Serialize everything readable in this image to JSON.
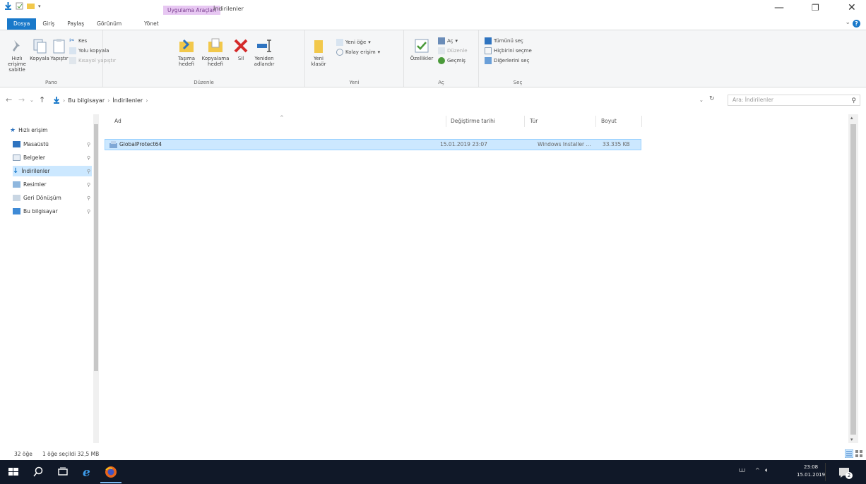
{
  "window": {
    "context_tab": "Uygulama Araçları",
    "title": "İndirilenler"
  },
  "ribbon_tabs": {
    "file": "Dosya",
    "home": "Giriş",
    "share": "Paylaş",
    "view": "Görünüm",
    "manage": "Yönet"
  },
  "ribbon": {
    "pin_quick": "Hızlı erişime sabitle",
    "copy": "Kopyala",
    "paste": "Yapıştır",
    "cut": "Kes",
    "copy_path": "Yolu kopyala",
    "paste_shortcut": "Kısayol yapıştır",
    "clipboard_label": "Pano",
    "move_to": "Taşıma hedefi",
    "copy_to": "Kopyalama hedefi",
    "delete": "Sil",
    "rename": "Yeniden adlandır",
    "organize_label": "Düzenle",
    "new_folder": "Yeni klasör",
    "new_item": "Yeni öğe",
    "easy_access": "Kolay erişim",
    "new_label": "Yeni",
    "properties": "Özellikler",
    "open": "Aç",
    "edit": "Düzenle",
    "history": "Geçmiş",
    "open_label": "Aç",
    "select_all": "Tümünü seç",
    "select_none": "Hiçbirini seçme",
    "invert_selection": "Diğerlerini seç",
    "select_label": "Seç"
  },
  "address": {
    "seg1": "Bu bilgisayar",
    "seg2": "İndirilenler",
    "search_placeholder": "Ara: İndirilenler"
  },
  "nav_pane": {
    "quick_access": "Hızlı erişim",
    "items": [
      {
        "label": "Masaüstü"
      },
      {
        "label": "Belgeler"
      },
      {
        "label": "İndirilenler"
      },
      {
        "label": "Resimler"
      },
      {
        "label": "Geri Dönüşüm"
      },
      {
        "label": "Bu bilgisayar"
      }
    ]
  },
  "columns": {
    "name": "Ad",
    "modified": "Değiştirme tarihi",
    "type": "Tür",
    "size": "Boyut"
  },
  "files": [
    {
      "name": "GlobalProtect64",
      "modified": "15.01.2019 23:07",
      "type": "Windows Installer ...",
      "size": "33.335 KB"
    }
  ],
  "status": {
    "count": "32 öğe",
    "selection": "1 öğe seçildi 32,5 MB"
  },
  "taskbar": {
    "time": "23:08",
    "date": "15.01.2019",
    "notif_count": "2"
  },
  "colors": {
    "accent": "#1979ca",
    "selection": "#cce8ff",
    "taskbar": "#101828"
  }
}
